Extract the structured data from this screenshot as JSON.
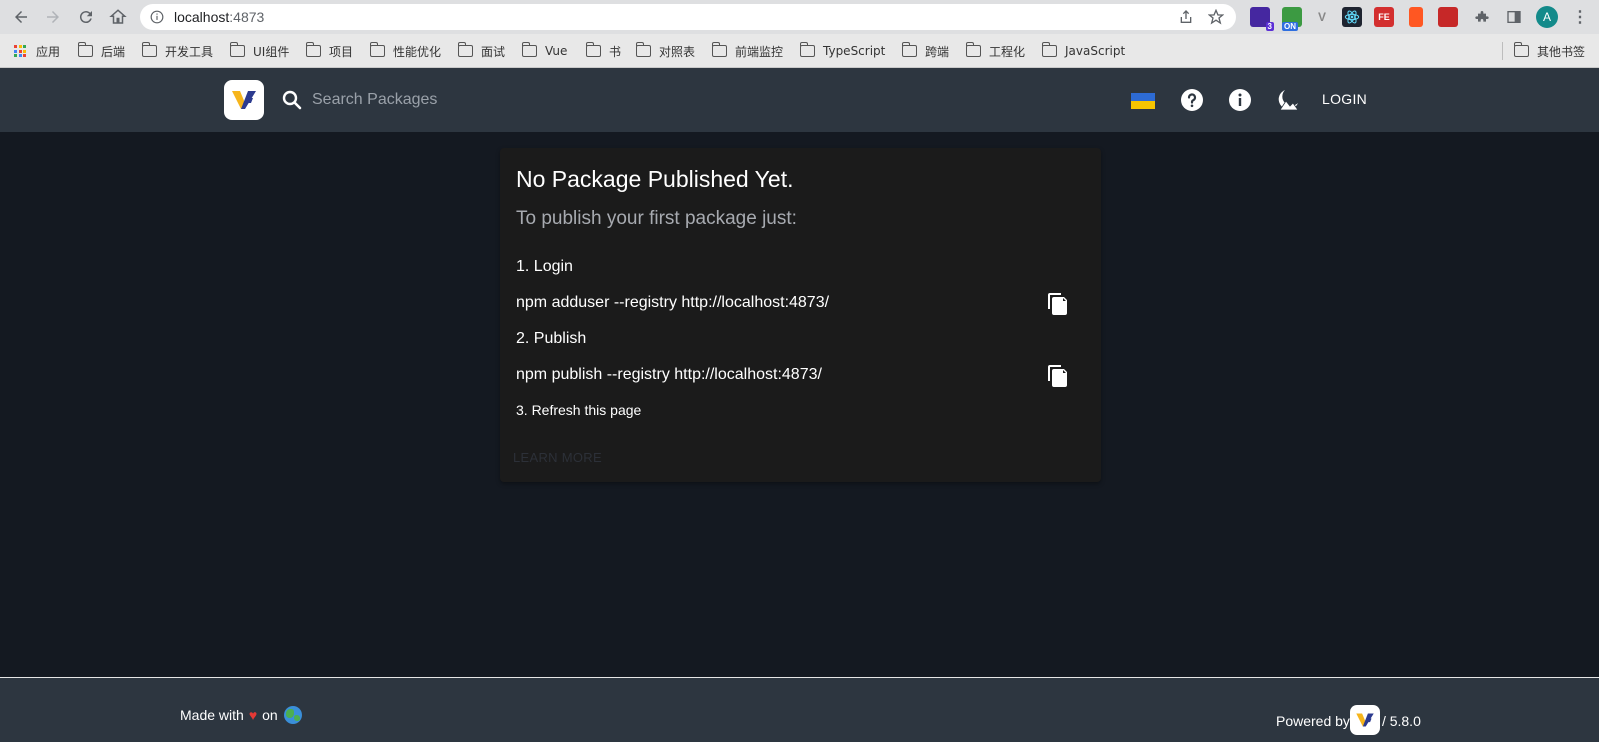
{
  "browser": {
    "url_host": "localhost",
    "url_port": ":4873",
    "bookmarks": [
      "应用",
      "后端",
      "开发工具",
      "UI组件",
      "项目",
      "性能优化",
      "面试",
      "Vue",
      "书",
      "对照表",
      "前端监控",
      "TypeScript",
      "跨端",
      "工程化",
      "JavaScript"
    ],
    "other_bookmarks": "其他书签",
    "ext_badge_count": "3",
    "ext_on_label": "ON",
    "ext_fe_label": "FE",
    "profile_initial": "A"
  },
  "header": {
    "search_placeholder": "Search Packages",
    "login_label": "LOGIN"
  },
  "card": {
    "title": "No Package Published Yet.",
    "subtitle": "To publish your first package just:",
    "step1": "1. Login",
    "cmd1": "npm adduser --registry http://localhost:4873/",
    "step2": "2. Publish",
    "cmd2": "npm publish --registry http://localhost:4873/",
    "step3": "3. Refresh this page",
    "learn_more": "LEARN MORE"
  },
  "footer": {
    "made_with": "Made with",
    "heart": "♥",
    "on": "on",
    "powered_by": "Powered by",
    "version": "/ 5.8.0"
  },
  "colors": {
    "header_bg": "#2d3640",
    "page_bg": "#141921",
    "card_bg": "#1b1b1b",
    "heart": "#e53935"
  }
}
